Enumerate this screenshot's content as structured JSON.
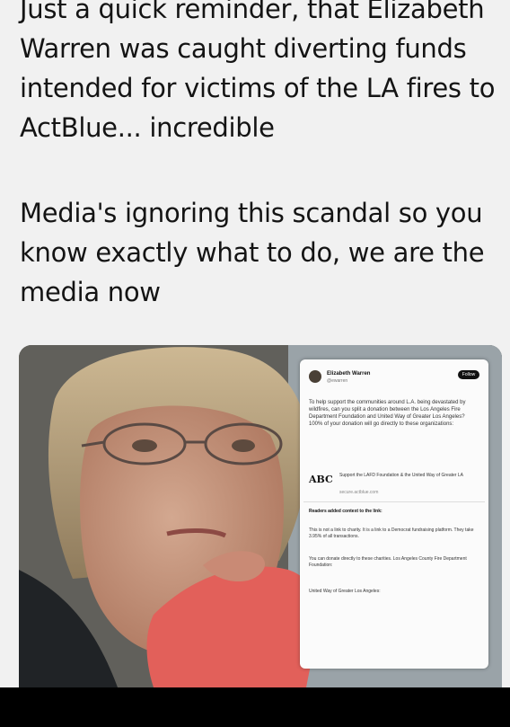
{
  "post": {
    "paragraph1": "Just a quick reminder, that Elizabeth Warren was caught diverting funds intended for victims of the LA fires to ActBlue... incredible",
    "paragraph2": "Media's ignoring this scandal so you know exactly what to do, we are the media now"
  },
  "embedded_tweet": {
    "name": "Elizabeth Warren",
    "handle": "@ewarren",
    "follow_label": "Follow",
    "body": "To help support the communities around L.A. being devastated by wildfires, can you split a donation between the Los Angeles Fire Department Foundation and United Way of Greater Los Angeles? 100% of your donation will go directly to these organizations:",
    "link_logo": "ABC",
    "link_title": "Support the LAFD Foundation & the United Way of Greater LA",
    "link_url": "secure.actblue.com",
    "note_header": "Readers added context to the link:",
    "note_1": "This is not a link to charity. It is a link to a Democrat fundraising platform. They take 3.95% of all transactions.",
    "note_2": "You can donate directly to these charities. Los Angeles County Fire Department Foundation:",
    "note_3": "United Way of Greater Los Angeles:"
  },
  "colors": {
    "background": "#f1f1f1",
    "text": "#141414",
    "bottom_bar": "#000000",
    "sleeve": "#e2605a"
  }
}
